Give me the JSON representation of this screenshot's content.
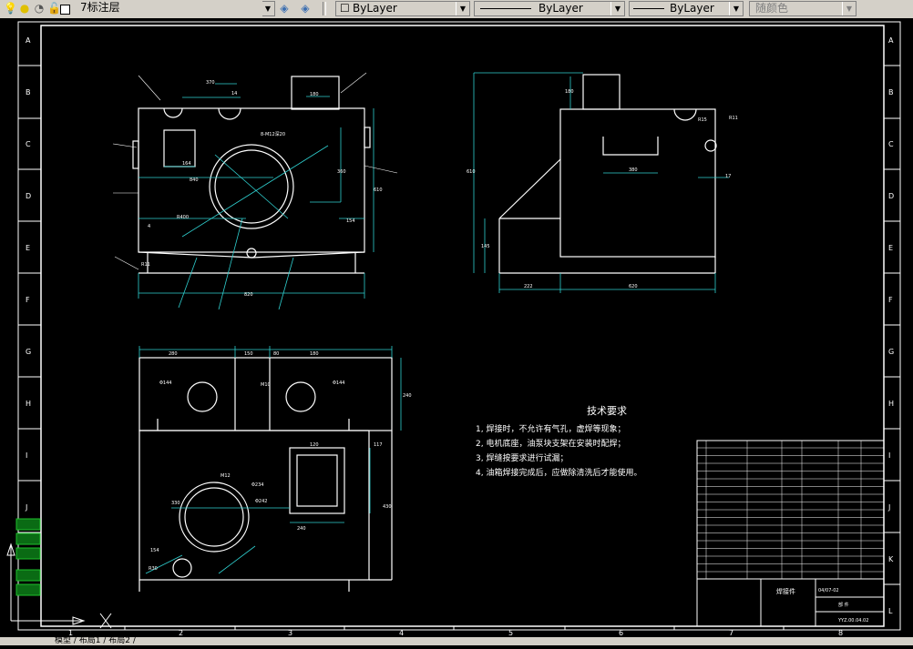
{
  "toolbar": {
    "layer_name": "7标注层",
    "color_control": "ByLayer",
    "linetype_control": "ByLayer",
    "lineweight_control": "ByLayer",
    "plotstyle_control": "随颜色",
    "icons": [
      "lightbulb-icon",
      "sun-icon",
      "lock-icon",
      "color-square-icon",
      "layers-icon",
      "layer-previous-icon"
    ]
  },
  "frame": {
    "row_letters": [
      "A",
      "B",
      "C",
      "D",
      "E",
      "F",
      "G",
      "H",
      "I",
      "J",
      "K",
      "L"
    ],
    "col_numbers": [
      "1",
      "2",
      "3",
      "4",
      "5",
      "6",
      "7",
      "8"
    ]
  },
  "tech_requirements": {
    "title": "技术要求",
    "items": [
      "1, 焊接时，不允许有气孔，虚焊等现象；",
      "2, 电机底座，油泵块支架在安装时配焊；",
      "3, 焊缝按要求进行试漏；",
      "4, 油箱焊接完成后，应做除清洗后才能使用。"
    ]
  },
  "title_block": {
    "drawing_number": "YYZ.00.04.02",
    "material": "焊接件",
    "part_code": "04/07-02",
    "assembly_label": "部 件"
  },
  "bottom_bar": {
    "text": "模型 / 布局1 / 布局2 /"
  }
}
